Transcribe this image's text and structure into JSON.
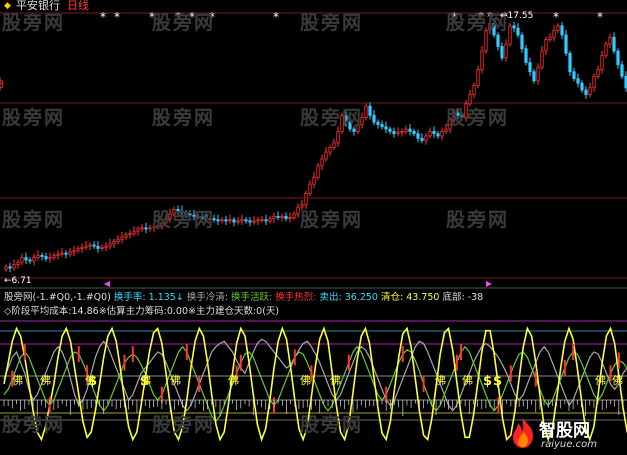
{
  "title": {
    "stock": "平安银行",
    "period": "日线"
  },
  "price_max_label": "17.55",
  "price_min_label": "6.71",
  "indicator_row1": [
    {
      "text": "股旁网(-1.#Q0,-1.#Q0)",
      "color": "#dddddd"
    },
    {
      "text": " 换手率: 1.135↓",
      "color": "#33ddff"
    },
    {
      "text": " 换手冷清:",
      "color": "#aaaaaa"
    },
    {
      "text": " 换手活跃:",
      "color": "#66cc33"
    },
    {
      "text": " 换手热烈:",
      "color": "#ff3333"
    },
    {
      "text": " 卖出: 36.250",
      "color": "#33ddff"
    },
    {
      "text": " 清仓: 43.750",
      "color": "#ffff33"
    },
    {
      "text": " 底部: -38",
      "color": "#dddddd"
    }
  ],
  "indicator_row2": "◇阶段平均成本:14.86※估算主力筹码:0.00※主力建仓天数:0(天)",
  "watermark": "股旁网",
  "markers": {
    "star": "*",
    "buy": "佛",
    "dollar": "$"
  },
  "logo": {
    "name": "智股网",
    "url": "raiyue.com"
  },
  "colors": {
    "up": "#ff3333",
    "down": "#33ccff",
    "grid": "#7a1c1c",
    "bg": "#000000"
  },
  "chart_data": [
    {
      "type": "candlestick",
      "title": "平安银行 日线",
      "x": [
        0,
        4,
        8,
        12,
        16,
        20,
        24,
        28,
        32,
        36,
        40,
        44,
        48,
        52,
        56,
        60,
        64,
        68,
        72,
        76,
        80,
        84,
        88,
        92,
        96,
        100,
        104,
        108,
        112,
        116,
        120,
        124,
        128,
        132,
        136,
        140,
        144,
        148,
        152,
        156,
        160,
        164,
        168,
        172,
        176,
        180,
        184,
        188,
        192,
        196,
        200,
        204,
        208,
        212,
        216,
        220,
        224,
        228,
        232,
        236,
        240,
        244,
        248,
        252,
        256,
        260,
        264,
        268,
        272,
        276,
        280,
        284,
        288,
        292,
        296,
        300,
        304,
        308,
        312,
        316,
        320,
        324,
        328,
        332,
        336,
        340,
        344,
        348,
        352,
        356,
        360,
        364,
        368,
        372,
        376,
        380,
        384,
        388,
        392,
        396,
        400,
        404,
        408,
        412,
        416,
        420,
        424,
        428,
        432,
        436,
        440,
        444,
        448,
        452,
        456,
        460,
        464,
        468,
        472,
        476,
        480,
        484,
        488,
        492,
        496,
        500,
        504,
        508,
        512,
        516,
        520,
        524,
        528,
        532,
        536,
        540,
        544,
        548,
        552,
        556,
        560,
        564,
        568,
        572,
        576,
        580,
        584,
        588,
        592,
        596,
        600,
        604,
        608,
        612,
        616,
        620
      ],
      "close": [
        6.9,
        6.85,
        7.0,
        7.1,
        7.3,
        7.2,
        7.15,
        7.3,
        7.4,
        7.35,
        7.25,
        7.3,
        7.4,
        7.45,
        7.5,
        7.45,
        7.55,
        7.6,
        7.7,
        7.75,
        7.8,
        7.85,
        7.8,
        7.7,
        7.75,
        7.8,
        7.9,
        8.0,
        8.1,
        8.2,
        8.3,
        8.35,
        8.45,
        8.55,
        8.6,
        8.55,
        8.6,
        8.65,
        8.7,
        8.8,
        9.0,
        9.2,
        9.4,
        9.35,
        9.25,
        9.2,
        9.15,
        9.1,
        9.1,
        9.0,
        8.95,
        9.0,
        8.95,
        8.9,
        8.95,
        8.9,
        8.95,
        8.85,
        8.9,
        8.95,
        8.9,
        8.85,
        8.9,
        8.95,
        8.95,
        8.9,
        9.0,
        9.1,
        9.05,
        9.1,
        9.0,
        9.05,
        9.2,
        9.5,
        9.6,
        10.1,
        10.5,
        10.8,
        11.3,
        11.6,
        11.9,
        12.1,
        12.3,
        12.8,
        13.5,
        13.2,
        12.9,
        12.8,
        13.1,
        13.4,
        13.9,
        13.5,
        13.2,
        13.1,
        13.0,
        12.9,
        12.8,
        12.7,
        12.75,
        12.8,
        12.9,
        12.8,
        12.7,
        12.5,
        12.4,
        12.6,
        12.8,
        12.7,
        12.6,
        12.8,
        12.9,
        13.3,
        13.6,
        13.5,
        13.4,
        14.0,
        14.4,
        14.8,
        15.5,
        16.3,
        17.2,
        17.5,
        17.0,
        16.5,
        16.0,
        16.6,
        17.4,
        17.3,
        17.0,
        16.4,
        15.8,
        15.4,
        15.0,
        15.6,
        16.3,
        16.8,
        16.9,
        17.2,
        17.4,
        17.0,
        16.2,
        15.4,
        15.1,
        14.9,
        14.6,
        14.4,
        14.7,
        15.2,
        15.5,
        16.1,
        16.6,
        16.9,
        16.3,
        15.7,
        15.2,
        14.7,
        14.9,
        15.0
      ],
      "ylim": [
        6.5,
        18.0
      ],
      "ylabel": ""
    },
    {
      "type": "line",
      "title": "股旁网",
      "x_count": 150,
      "ylim": [
        -60,
        60
      ],
      "series": [
        {
          "name": "换手冷清",
          "color": "#aaaaaa",
          "values": [
            5,
            15,
            25,
            30,
            20,
            10,
            -5,
            -15,
            -10,
            0,
            10,
            20,
            30,
            35,
            30,
            20,
            5,
            -10,
            -20,
            -15,
            -5,
            10,
            25,
            35,
            40,
            35,
            25,
            15,
            5,
            -5,
            -15,
            -10,
            0,
            10,
            15,
            20,
            25,
            30,
            28,
            20,
            10,
            0,
            -10,
            -20,
            -25,
            -20,
            -10,
            0,
            10,
            20,
            30,
            35,
            38,
            40,
            35,
            30,
            22,
            15,
            10,
            20,
            30,
            38,
            42,
            40,
            35,
            30,
            25,
            20,
            15,
            18,
            25,
            32,
            38,
            40,
            35,
            28,
            20,
            10,
            0,
            -10,
            -15,
            -10,
            0,
            10,
            20,
            30,
            35,
            32,
            25,
            15,
            5,
            -5,
            -15,
            -20,
            -15,
            -5,
            5,
            15,
            25,
            35,
            40,
            38,
            30,
            20,
            10,
            0,
            -10,
            -20,
            -25,
            -20,
            -10,
            0,
            10,
            20,
            28,
            35,
            38,
            35,
            30,
            25,
            18,
            10,
            0,
            -10,
            -15,
            -10,
            0,
            10,
            20,
            30,
            35,
            30,
            20,
            10,
            0,
            -10,
            -20,
            -15,
            -5,
            5,
            15,
            25,
            30,
            28,
            20,
            10,
            0,
            -5,
            0,
            10,
            15,
            20,
            25,
            30
          ]
        },
        {
          "name": "换手活跃",
          "color": "#66cc33",
          "values": [
            -10,
            -5,
            5,
            15,
            25,
            30,
            25,
            15,
            5,
            -5,
            -15,
            -20,
            -15,
            -5,
            5,
            15,
            25,
            30,
            28,
            20,
            10,
            0,
            -10,
            -20,
            -25,
            -20,
            -10,
            0,
            10,
            20,
            25,
            28,
            25,
            18,
            10,
            0,
            -10,
            -15,
            -10,
            0,
            10,
            20,
            30,
            35,
            30,
            20,
            10,
            0,
            -10,
            -20,
            -30,
            -35,
            -30,
            -20,
            -10,
            0,
            10,
            20,
            28,
            30,
            25,
            15,
            5,
            -5,
            -15,
            -20,
            -15,
            -5,
            5,
            15,
            25,
            30,
            28,
            20,
            10,
            0,
            -10,
            -20,
            -25,
            -20,
            -10,
            0,
            10,
            20,
            30,
            35,
            30,
            20,
            10,
            0,
            -10,
            -15,
            -10,
            0,
            10,
            20,
            28,
            32,
            30,
            22,
            12,
            0,
            -10,
            -20,
            -25,
            -20,
            -10,
            0,
            10,
            20,
            30,
            35,
            30,
            20,
            10,
            0,
            -10,
            -20,
            -25,
            -20,
            -10,
            0,
            10,
            20,
            28,
            30,
            25,
            15,
            5,
            -5,
            -15,
            -20,
            -15,
            -5,
            5,
            15,
            25,
            30,
            28,
            20,
            10,
            0,
            -10,
            -15,
            -10,
            0,
            10,
            18,
            22,
            20,
            15,
            10
          ]
        },
        {
          "name": "清仓",
          "color": "#ffff33",
          "values": [
            0,
            20,
            40,
            52,
            45,
            25,
            0,
            -25,
            -45,
            -52,
            -40,
            -20,
            0,
            25,
            45,
            52,
            40,
            15,
            -10,
            -35,
            -50,
            -45,
            -25,
            0,
            25,
            45,
            52,
            40,
            15,
            -15,
            -40,
            -52,
            -45,
            -20,
            5,
            30,
            48,
            52,
            38,
            10,
            -20,
            -45,
            -52,
            -40,
            -15,
            15,
            40,
            52,
            45,
            20,
            -10,
            -38,
            -52,
            -45,
            -20,
            10,
            38,
            52,
            45,
            20,
            -10,
            -38,
            -52,
            -42,
            -15,
            15,
            40,
            52,
            42,
            15,
            -15,
            -42,
            -52,
            -40,
            -12,
            18,
            42,
            52,
            40,
            10,
            -20,
            -45,
            -52,
            -38,
            -8,
            22,
            45,
            52,
            38,
            8,
            -22,
            -46,
            -52,
            -35,
            -5,
            25,
            47,
            52,
            35,
            5,
            -25,
            -48,
            -52,
            -32,
            -2,
            28,
            48,
            52,
            32,
            2,
            -28,
            -50,
            -50,
            -30,
            0,
            30,
            50,
            50,
            28,
            -2,
            -32,
            -52,
            -48,
            -25,
            5,
            35,
            52,
            45,
            20,
            -10,
            -40,
            -52,
            -42,
            -15,
            15,
            40,
            52,
            42,
            15,
            -15,
            -42,
            -52,
            -40,
            -10,
            20,
            45,
            52,
            38,
            8,
            -22,
            -45,
            -50
          ]
        }
      ]
    }
  ]
}
